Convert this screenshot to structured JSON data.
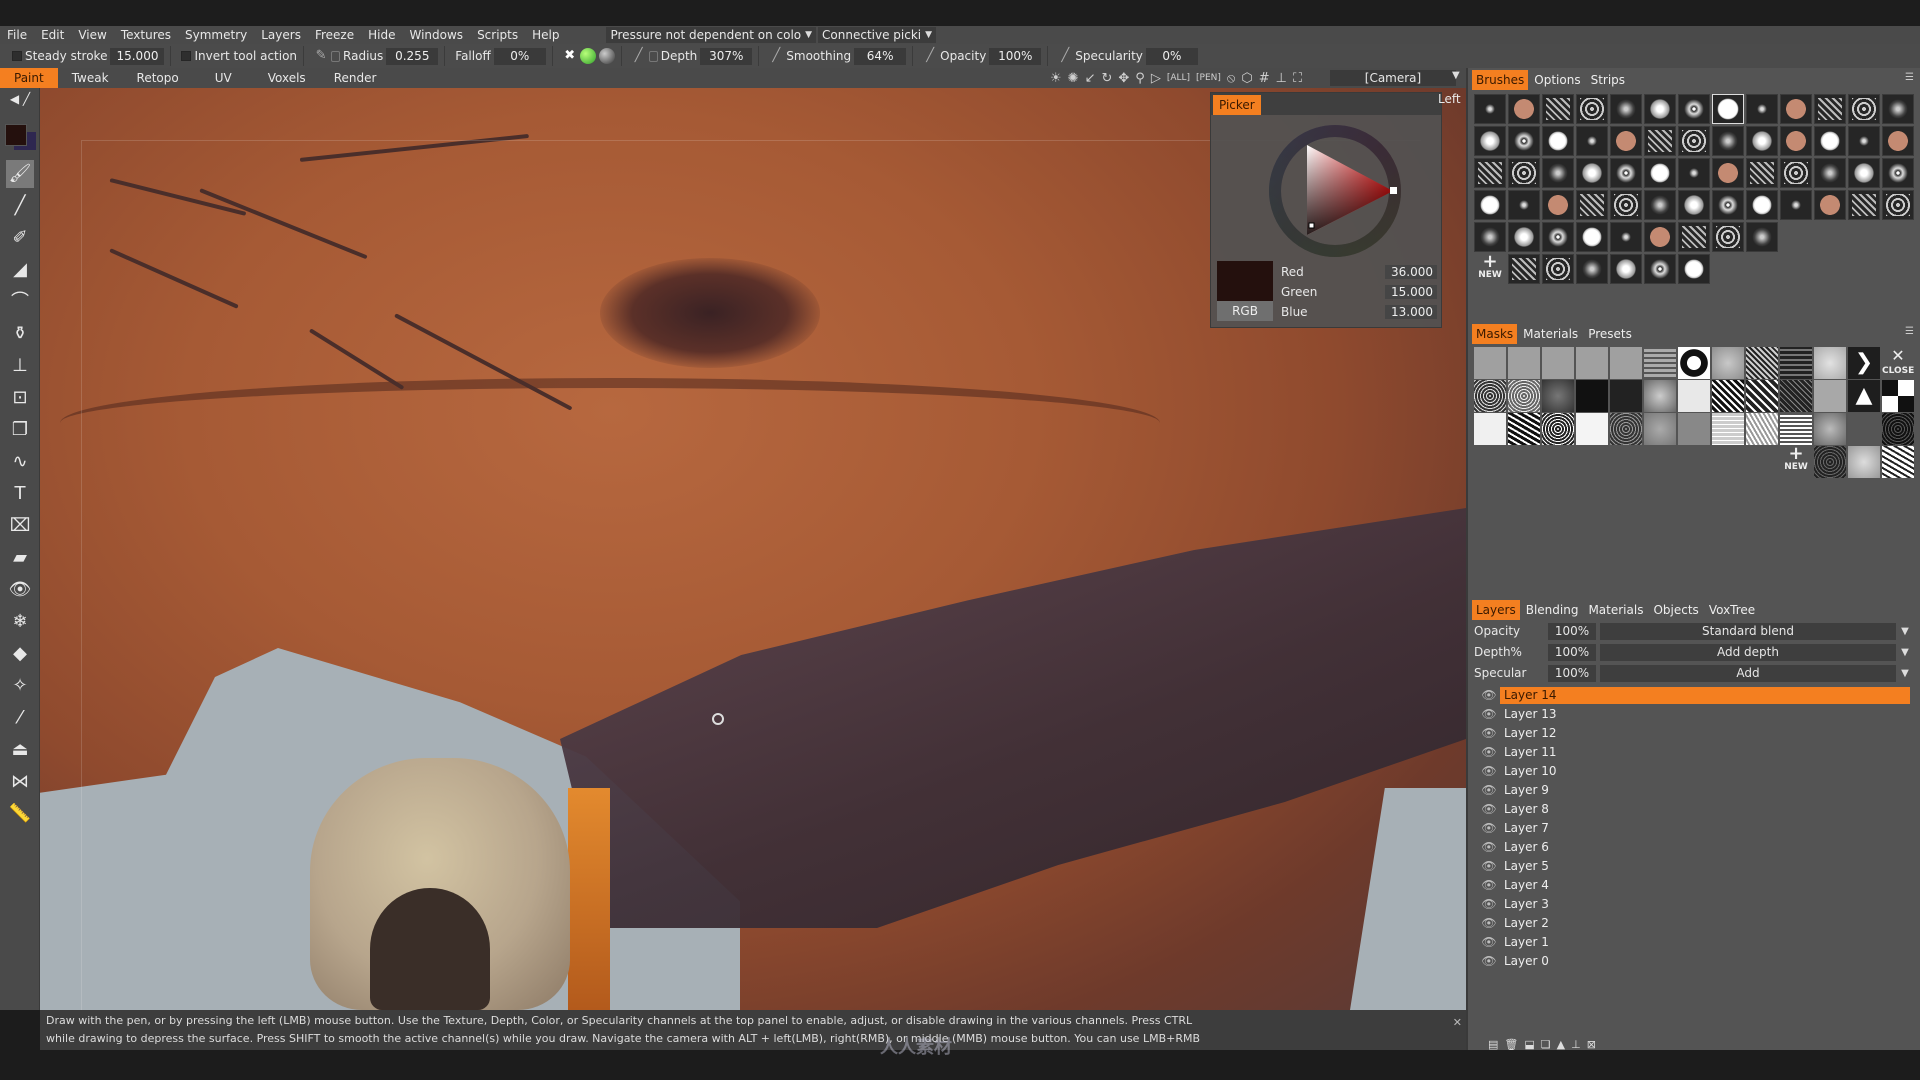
{
  "menubar": {
    "items": [
      "File",
      "Edit",
      "View",
      "Textures",
      "Symmetry",
      "Layers",
      "Freeze",
      "Hide",
      "Windows",
      "Scripts",
      "Help"
    ],
    "pressure_dropdown": "Pressure not dependent on colo",
    "picking_dropdown": "Connective picki"
  },
  "toolbar": {
    "steady_stroke": {
      "label": "Steady stroke",
      "value": "15.000"
    },
    "invert_tool_action": {
      "label": "Invert tool action"
    },
    "radius": {
      "label": "Radius",
      "value": "0.255"
    },
    "falloff": {
      "label": "Falloff",
      "value": "0%"
    },
    "depth": {
      "label": "Depth",
      "value": "307%"
    },
    "smoothing": {
      "label": "Smoothing",
      "value": "64%"
    },
    "opacity": {
      "label": "Opacity",
      "value": "100%"
    },
    "specularity": {
      "label": "Specularity",
      "value": "0%"
    }
  },
  "modes": {
    "tabs": [
      "Paint",
      "Tweak",
      "Retopo",
      "UV",
      "Voxels",
      "Render"
    ],
    "active": "Paint"
  },
  "nav_icons": [
    "sun-light-icon",
    "bulb-light-icon",
    "light-direction-icon",
    "rotate-icon",
    "move-icon",
    "zoom-icon",
    "play-icon",
    "fit-all-icon",
    "pen-view-icon",
    "no-symbol-icon",
    "cube-view-icon",
    "grid-icon",
    "axis-icon",
    "fullscreen-icon"
  ],
  "camera": {
    "value": "[Camera]"
  },
  "view_label": "Left",
  "picker": {
    "tab": "Picker",
    "mode_button": "RGB",
    "red": {
      "label": "Red",
      "value": "36.000"
    },
    "green": {
      "label": "Green",
      "value": "15.000"
    },
    "blue": {
      "label": "Blue",
      "value": "13.000"
    },
    "current_color": "#240f0d"
  },
  "brushes_panel": {
    "tabs": [
      "Brushes",
      "Options",
      "Strips"
    ],
    "active": "Brushes",
    "new_label": "NEW",
    "count": 68
  },
  "masks_panel": {
    "tabs": [
      "Masks",
      "Materials",
      "Presets"
    ],
    "active": "Masks",
    "new_label": "NEW",
    "close_label": "CLOSE"
  },
  "layers_panel": {
    "tabs": [
      "Layers",
      "Blending",
      "Materials",
      "Objects",
      "VoxTree"
    ],
    "active": "Layers",
    "props": [
      {
        "label": "Opacity",
        "value": "100%",
        "mode": "Standard blend"
      },
      {
        "label": "Depth%",
        "value": "100%",
        "mode": "Add depth"
      },
      {
        "label": "Specular",
        "value": "100%",
        "mode": "Add"
      }
    ],
    "layers": [
      "Layer 14",
      "Layer 13",
      "Layer 12",
      "Layer 11",
      "Layer 10",
      "Layer 9",
      "Layer 8",
      "Layer 7",
      "Layer 6",
      "Layer 5",
      "Layer 4",
      "Layer 3",
      "Layer 2",
      "Layer 1",
      "Layer 0"
    ],
    "active_layer": "Layer 14"
  },
  "status": {
    "line1": "Draw with the pen, or by pressing the left (LMB) mouse button. Use the Texture, Depth, Color, or Specularity channels at the top panel to enable, adjust, or disable drawing in the various channels. Press CTRL",
    "line2": "while drawing to depress the surface. Press SHIFT to smooth the active channel(s) while you draw. Navigate the camera with ALT + left(LMB), right(RMB), or middle (MMB) mouse button. You can use LMB+RMB"
  },
  "watermark": "人人素材",
  "colors": {
    "accent": "#f47f20",
    "panel": "#545454",
    "toolbar": "#4b4b4b"
  }
}
